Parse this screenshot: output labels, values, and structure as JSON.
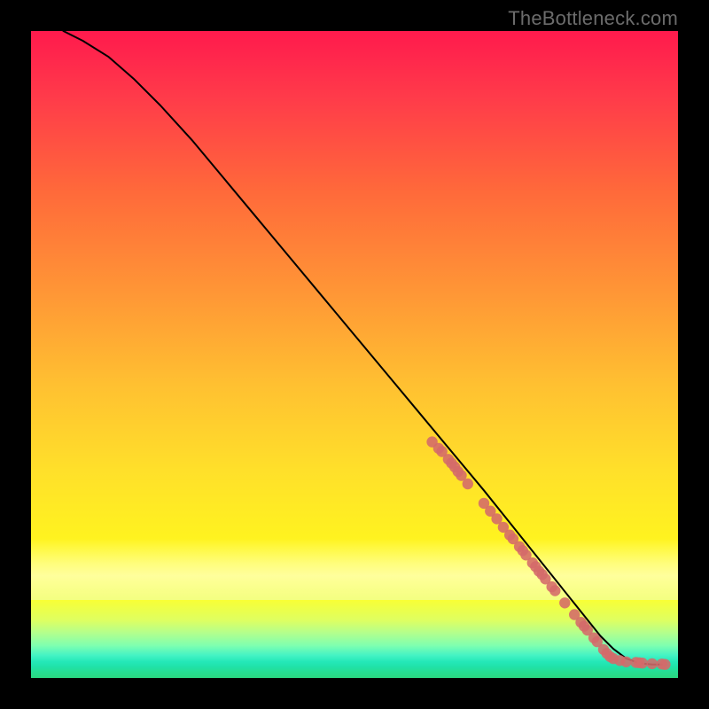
{
  "watermark": "TheBottleneck.com",
  "chart_data": {
    "type": "line",
    "title": "",
    "xlabel": "",
    "ylabel": "",
    "xlim": [
      0,
      100
    ],
    "ylim": [
      0,
      100
    ],
    "grid": false,
    "series": [
      {
        "name": "curve",
        "color": "#000000",
        "x": [
          5,
          8,
          12,
          16,
          20,
          25,
          30,
          35,
          40,
          45,
          50,
          55,
          60,
          65,
          70,
          74,
          76,
          78,
          80,
          82,
          84,
          86,
          88,
          90,
          92,
          94,
          96,
          97.5
        ],
        "y": [
          100,
          98.5,
          96,
          92.5,
          88.5,
          83,
          77,
          71,
          65,
          59,
          53,
          47,
          41,
          35,
          29,
          24,
          21.5,
          19,
          16.5,
          14,
          11.5,
          9,
          6.5,
          4.5,
          3,
          2.3,
          2.1,
          2.1
        ]
      }
    ],
    "points": {
      "name": "data-markers",
      "color": "#d46a6a",
      "x": [
        62,
        63,
        63.5,
        64.5,
        65,
        65.5,
        66,
        66.5,
        67.5,
        70,
        71,
        72,
        73,
        74,
        74.5,
        75.5,
        76,
        76.5,
        77.5,
        78,
        78.5,
        79,
        79.5,
        80.5,
        81,
        82.5,
        84,
        85,
        85.5,
        86,
        87,
        87.5,
        88.5,
        89,
        89.5,
        90,
        91,
        92,
        93.5,
        94,
        94.5,
        96,
        97.5,
        98
      ],
      "y": [
        36.5,
        35.5,
        35,
        33.8,
        33.2,
        32.6,
        31.9,
        31.3,
        30,
        27,
        25.8,
        24.6,
        23.3,
        22.1,
        21.5,
        20.3,
        19.7,
        19,
        17.8,
        17.2,
        16.5,
        16,
        15.3,
        14.1,
        13.5,
        11.6,
        9.8,
        8.6,
        8,
        7.4,
        6.2,
        5.6,
        4.4,
        3.8,
        3.3,
        3,
        2.7,
        2.5,
        2.4,
        2.35,
        2.3,
        2.2,
        2.15,
        2.1
      ]
    },
    "background_gradient": {
      "top": "#ff1a4d",
      "mid_upper": "#ff9536",
      "mid": "#fff220",
      "bottom": "#2ad880"
    }
  }
}
